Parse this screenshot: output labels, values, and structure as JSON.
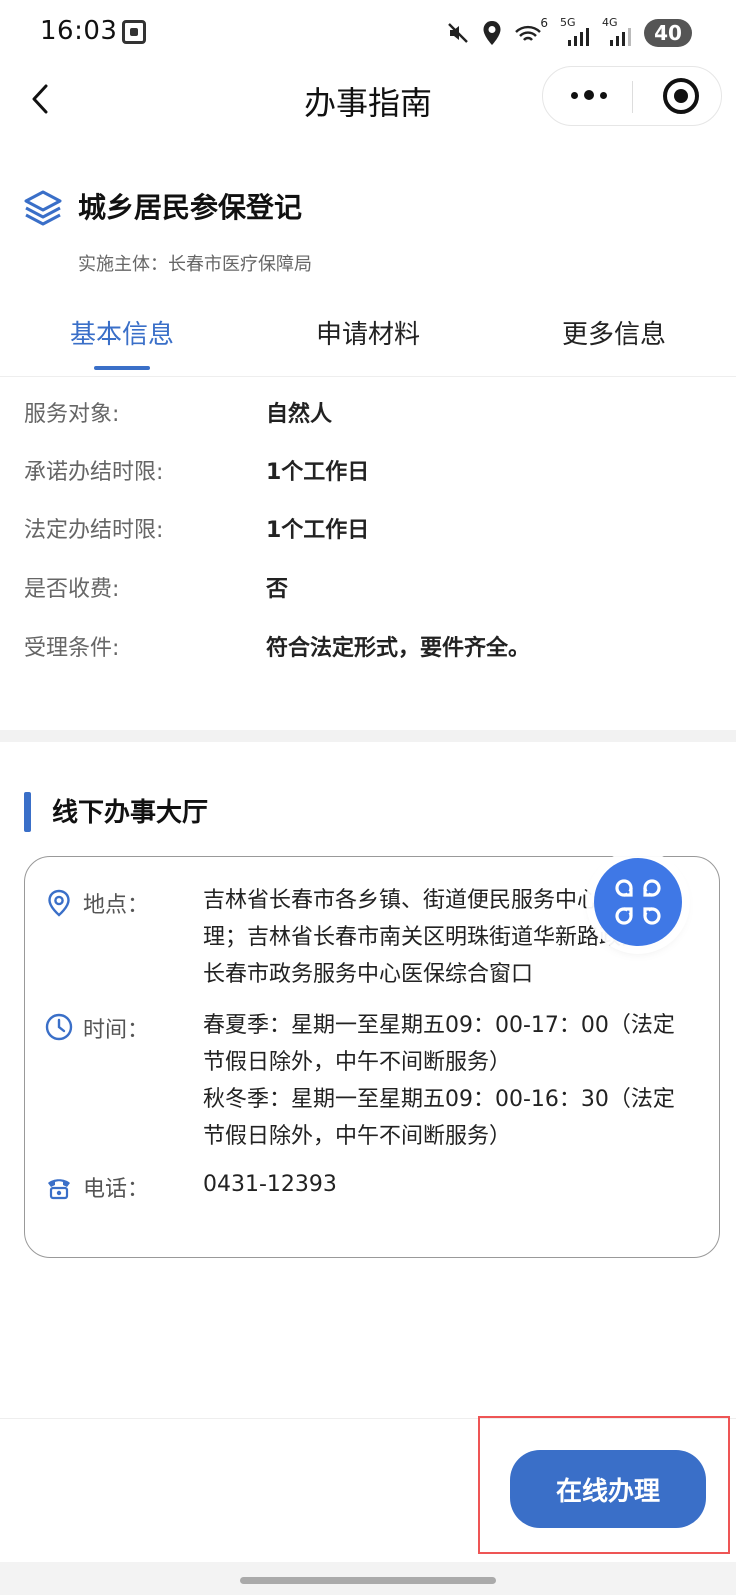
{
  "status_bar": {
    "time": "16:03",
    "battery": "40",
    "icons": [
      "mute-icon",
      "location-icon",
      "wifi-icon",
      "signal-5g-icon",
      "signal-4g-icon"
    ],
    "labels": [
      "6",
      "5G",
      "4G"
    ]
  },
  "nav": {
    "title": "办事指南"
  },
  "service": {
    "title": "城乡居民参保登记",
    "subject": "实施主体：长春市医疗保障局"
  },
  "tabs": [
    {
      "label": "基本信息",
      "active": true
    },
    {
      "label": "申请材料",
      "active": false
    },
    {
      "label": "更多信息",
      "active": false
    }
  ],
  "basic_info": [
    {
      "label": "服务对象:",
      "value": "自然人"
    },
    {
      "label": "承诺办结时限:",
      "value": "1个工作日"
    },
    {
      "label": "法定办结时限:",
      "value": "1个工作日"
    },
    {
      "label": "是否收费:",
      "value": "否"
    },
    {
      "label": "受理条件:",
      "value": "符合法定形式，要件齐全。"
    }
  ],
  "offline_hall": {
    "title": "线下办事大厅",
    "address_label": "地点：",
    "address": "吉林省长春市各乡镇、街道便民服务中心受\n理；吉林省长春市南关区明珠街道华新路政务\n长春市政务服务中心医保综合窗口",
    "time_label": "时间：",
    "time": "春夏季：星期一至星期五09：00-17：00（法定\n节假日除外，中午不间断服务）\n秋冬季：星期一至星期五09：00-16：30（法定\n节假日除外，中午不间断服务）",
    "phone_label": "电话：",
    "phone": "0431-12393"
  },
  "actions": {
    "online_label": "在线办理"
  },
  "colors": {
    "accent": "#3a6fc8",
    "highlight": "#e55555"
  }
}
